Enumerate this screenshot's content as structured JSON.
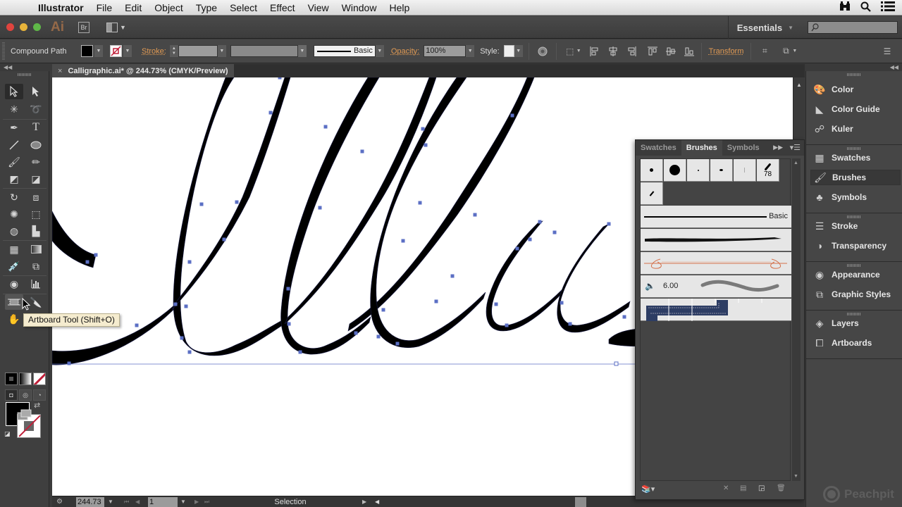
{
  "menubar": {
    "app": "Illustrator",
    "items": [
      "File",
      "Edit",
      "Object",
      "Type",
      "Select",
      "Effect",
      "View",
      "Window",
      "Help"
    ],
    "right_icons": [
      "binoculars-icon",
      "spotlight-search-icon",
      "notification-list-icon"
    ]
  },
  "appbar": {
    "logo": "Ai",
    "bridge_label": "Br",
    "workspace": "Essentials",
    "search_placeholder": ""
  },
  "control_bar": {
    "selection_type": "Compound Path",
    "fill_color": "#000000",
    "stroke_label": "Stroke:",
    "stroke_weight": "",
    "brush_label": "Basic",
    "opacity_label": "Opacity:",
    "opacity_value": "100%",
    "style_label": "Style:",
    "transform_label": "Transform"
  },
  "document": {
    "tab_title": "Calligraphic.ai* @ 244.73% (CMYK/Preview)",
    "close_symbol": "×"
  },
  "statusbar": {
    "zoom": "244.73",
    "artboard": "1",
    "status": "Selection"
  },
  "tooltip": "Artboard Tool (Shift+O)",
  "brushes_panel": {
    "tabs": [
      {
        "label": "Swatches",
        "active": false
      },
      {
        "label": "Brushes",
        "active": true
      },
      {
        "label": "Symbols",
        "active": false
      }
    ],
    "calligraphic_size_label": "78",
    "basic_label": "Basic",
    "bristle_value": "6.00"
  },
  "dock": {
    "groups": [
      [
        "Color",
        "Color Guide",
        "Kuler"
      ],
      [
        "Swatches",
        "Brushes",
        "Symbols"
      ],
      [
        "Stroke",
        "Transparency"
      ],
      [
        "Appearance",
        "Graphic Styles"
      ],
      [
        "Layers",
        "Artboards"
      ]
    ],
    "active_item": "Brushes"
  },
  "watermark": "Peachpit",
  "colors": {
    "accent_orange": "#e09a54",
    "anchor_blue": "#5b6fc4",
    "none_red": "#c0203a"
  }
}
